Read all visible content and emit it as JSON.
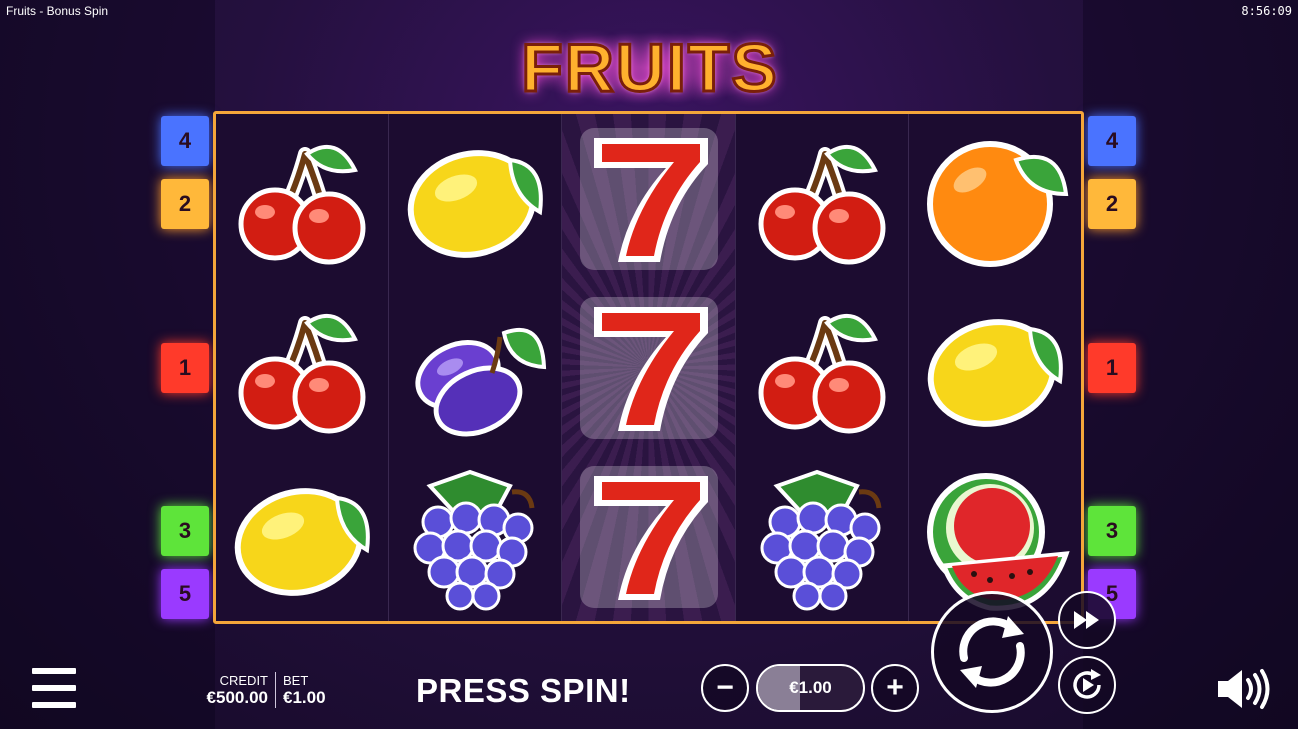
{
  "window": {
    "title": "Fruits - Bonus Spin",
    "clock": "8:56:09"
  },
  "logo": {
    "text": "FRUITS"
  },
  "reels": [
    [
      "cherry",
      "cherry",
      "lemon"
    ],
    [
      "lemon",
      "plum",
      "grapes"
    ],
    [
      "seven",
      "seven",
      "seven"
    ],
    [
      "cherry",
      "cherry",
      "grapes"
    ],
    [
      "orange",
      "lemon",
      "watermelon"
    ]
  ],
  "paylines_left": [
    {
      "number": "4",
      "color": "#4a73ff"
    },
    {
      "number": "2",
      "color": "#ffb83a"
    },
    {
      "number": "1",
      "color": "#ff3a2a"
    },
    {
      "number": "3",
      "color": "#5ee43a"
    },
    {
      "number": "5",
      "color": "#9a3aff"
    }
  ],
  "paylines_right": [
    {
      "number": "4",
      "color": "#4a73ff"
    },
    {
      "number": "2",
      "color": "#ffb83a"
    },
    {
      "number": "1",
      "color": "#ff3a2a"
    },
    {
      "number": "3",
      "color": "#5ee43a"
    },
    {
      "number": "5",
      "color": "#9a3aff"
    }
  ],
  "footer": {
    "credit_label": "CREDIT",
    "credit_value": "€500.00",
    "bet_label": "BET",
    "bet_value": "€1.00",
    "message": "PRESS SPIN!",
    "bet_selector_value": "€1.00",
    "minus": "−",
    "plus": "+"
  },
  "icons": {
    "menu": "menu-icon",
    "spin": "spin-arrows-icon",
    "fast_forward": "fast-forward-icon",
    "autoplay": "autoplay-icon",
    "sound": "speaker-icon"
  }
}
